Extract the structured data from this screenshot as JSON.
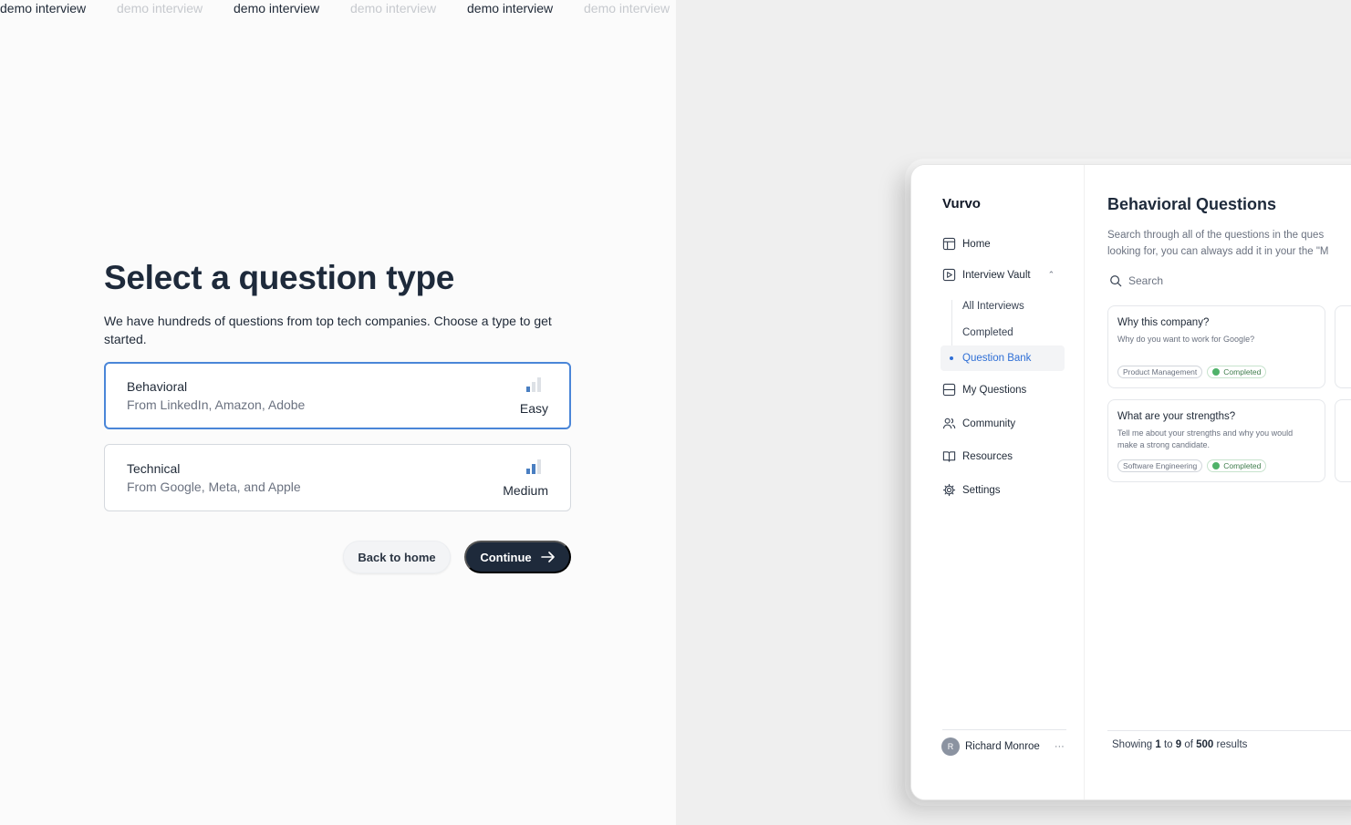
{
  "marquee": [
    "demo interview",
    "demo interview",
    "demo interview",
    "demo interview",
    "demo interview",
    "demo interview"
  ],
  "page": {
    "title": "Select a question type",
    "subtitle": "We have hundreds of questions from top tech companies. Choose a type to get started."
  },
  "options": [
    {
      "name": "Behavioral",
      "companies": "From LinkedIn, Amazon, Adobe",
      "difficulty": "Easy",
      "difficulty_level": 1,
      "selected": true
    },
    {
      "name": "Technical",
      "companies": "From Google, Meta, and Apple",
      "difficulty": "Medium",
      "difficulty_level": 2,
      "selected": false
    }
  ],
  "actions": {
    "back": "Back to home",
    "continue": "Continue"
  },
  "preview": {
    "brand": "Vurvo",
    "nav": [
      "Home",
      "Interview Vault",
      "My Questions",
      "Community",
      "Resources",
      "Settings"
    ],
    "subnav": [
      "All Interviews",
      "Completed",
      "Question Bank"
    ],
    "user": {
      "initial": "R",
      "name": "Richard Monroe",
      "more": "···"
    },
    "main_title": "Behavioral Questions",
    "description_line1": "Search through all of the questions in the ques",
    "description_line2": "looking for, you can always add it in your the \"M",
    "search_placeholder": "Search",
    "questions": [
      {
        "title": "Why this company?",
        "desc": "Why do you want to work for Google?",
        "tag": "Product Management",
        "status": "Completed"
      },
      {
        "title": "What are your strengths?",
        "desc": "Tell me about your strengths and why you would make a strong candidate.",
        "tag": "Software Engineering",
        "status": "Completed"
      }
    ],
    "pagination": {
      "prefix": "Showing",
      "from": "1",
      "to_word": "to",
      "to": "9",
      "of_word": "of",
      "total": "500",
      "suffix": "results"
    }
  },
  "colors": {
    "accent": "#4a86d8",
    "primary": "#1e2a3b",
    "link": "#2f6fd6",
    "success": "#4fb269"
  }
}
